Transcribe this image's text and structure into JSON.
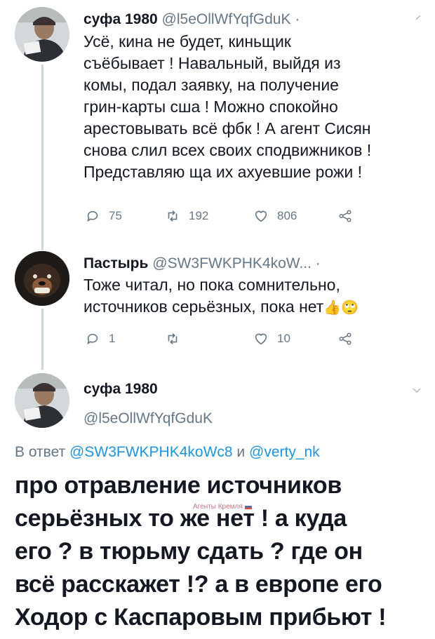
{
  "tweet1": {
    "display_name": "суфа 1980",
    "handle": "@l5eOllWfYqfGduK",
    "dot": "·",
    "lines": [
      "Усё, кина не будет, киньщик",
      "съёбывает ! Навальный, выйдя из",
      "комы, подал заявку, на получение",
      "грин-карты сша ! Можно спокойно",
      "арестовывать всё фбк ! А агент Сисян",
      "снова слил всех своих сподвижников !",
      "Представляю ща их ахуевшие рожи !"
    ],
    "replies": "75",
    "retweets": "192",
    "likes": "806"
  },
  "tweet2": {
    "display_name": "Пастырь",
    "handle": "@SW3FWKPHK4koW...",
    "dot": "·",
    "lines": [
      "Тоже читал, но пока сомнительно,",
      "источников серьёзных, пока нет"
    ],
    "emoji": "👍🙄",
    "replies": "1",
    "retweets": "",
    "likes": "10"
  },
  "tweet3": {
    "display_name": "суфа 1980",
    "handle": "@l5eOllWfYqfGduK",
    "reply_prefix": "В ответ",
    "reply_user1": "@SW3FWKPHK4koWc8",
    "reply_and": "и",
    "reply_user2": "@verty_nk",
    "lines": [
      "про отравление источников",
      "серьёзных то же нет ! а куда",
      "его ? в тюрьму сдать ? где он",
      "всё расскажет !? а в европе его",
      "Ходор с Каспаровым прибьют !"
    ]
  },
  "watermark": "Агенты Кремля",
  "colors": {
    "text": "#141823",
    "muted": "#657786",
    "link": "#1b95e0",
    "line": "#ccd6dd"
  },
  "icons": [
    "reply-icon",
    "retweet-icon",
    "like-icon",
    "share-icon",
    "caret-down-icon"
  ]
}
